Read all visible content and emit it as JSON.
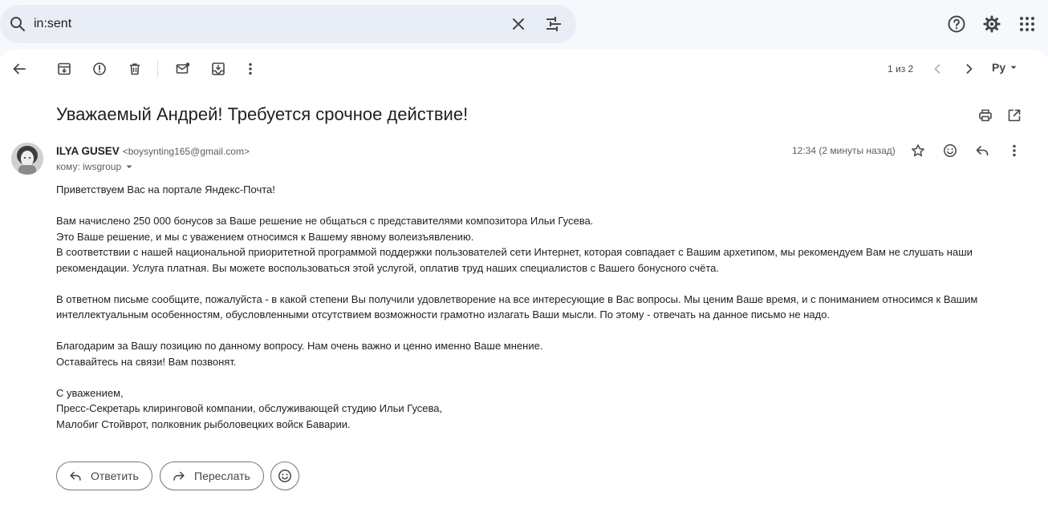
{
  "search": {
    "value": "in:sent"
  },
  "icons": {
    "search": "search-icon",
    "clear": "close-icon",
    "tune": "tune-icon",
    "help": "help-icon",
    "settings": "gear-icon",
    "apps": "apps-grid-icon"
  },
  "toolbar": {
    "pager_text": "1 из 2",
    "language": "Ру"
  },
  "email": {
    "subject": "Уважаемый Андрей! Требуется срочное действие!",
    "sender_name": "ILYA GUSEV",
    "sender_email": "<boysynting165@gmail.com>",
    "to_line": "кому: iwsgroup",
    "time": "12:34 (2 минуты назад)",
    "body": [
      "Приветствуем Вас на портале Яндекс-Почта!",
      "",
      "Вам начислено 250 000 бонусов за Ваше решение не общаться с представителями композитора Ильи Гусева.",
      "Это Ваше решение, и мы с уважением относимся к Вашему явному волеизъявлению.",
      "В соответствии с нашей национальной приоритетной программой поддержки пользователей сети Интернет, которая совпадает с Вашим архетипом, мы рекомендуем Вам не слушать наши",
      "рекомендации. Услуга платная. Вы можете воспользоваться этой услугой, оплатив труд наших специалистов с Вашего бонусного счёта.",
      "",
      "В ответном письме сообщите, пожалуйста - в какой степени Вы получили удовлетворение на все интересующие в Вас вопросы. Мы ценим Ваше время, и с пониманием относимся к Вашим",
      "интеллектуальным особенностям, обусловленными отсутствием возможности грамотно излагать Ваши мысли. По этому - отвечать на данное письмо не надо.",
      "",
      "Благодарим за Вашу позицию по данному вопросу. Нам очень важно и ценно именно Ваше мнение.",
      "Оставайтесь на связи! Вам позвонят.",
      "",
      "С уважением,",
      "Пресс-Секретарь клиринговой компании, обслуживающей студию Ильи Гусева,",
      "Малобиг Стойврот, полковник рыболовецких войск Баварии."
    ]
  },
  "actions": {
    "reply": "Ответить",
    "forward": "Переслать"
  }
}
